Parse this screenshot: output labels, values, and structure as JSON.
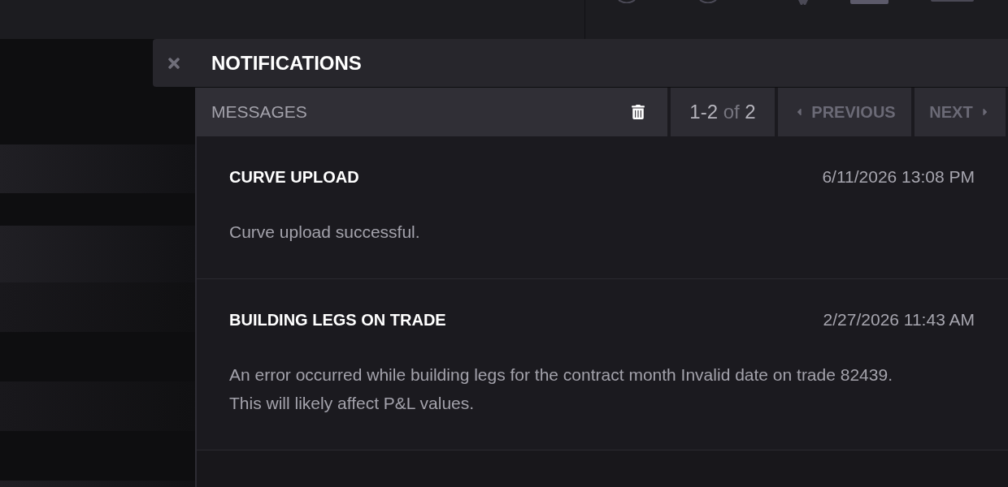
{
  "panel": {
    "title": "NOTIFICATIONS"
  },
  "toolbar": {
    "section_label": "MESSAGES",
    "count": {
      "range": "1-2",
      "joiner": "of",
      "total": "2"
    },
    "previous": {
      "label": "PREVIOUS",
      "disabled": true
    },
    "next": {
      "label": "NEXT",
      "disabled": true
    }
  },
  "messages": [
    {
      "title": "CURVE UPLOAD",
      "time": "6/11/2026 13:08 PM",
      "body": "Curve upload successful."
    },
    {
      "title": "BUILDING LEGS ON TRADE",
      "time": "2/27/2026 11:43 AM",
      "body": "An error occurred while building legs for the contract month Invalid date on trade 82439. This will likely affect P&L values."
    }
  ]
}
